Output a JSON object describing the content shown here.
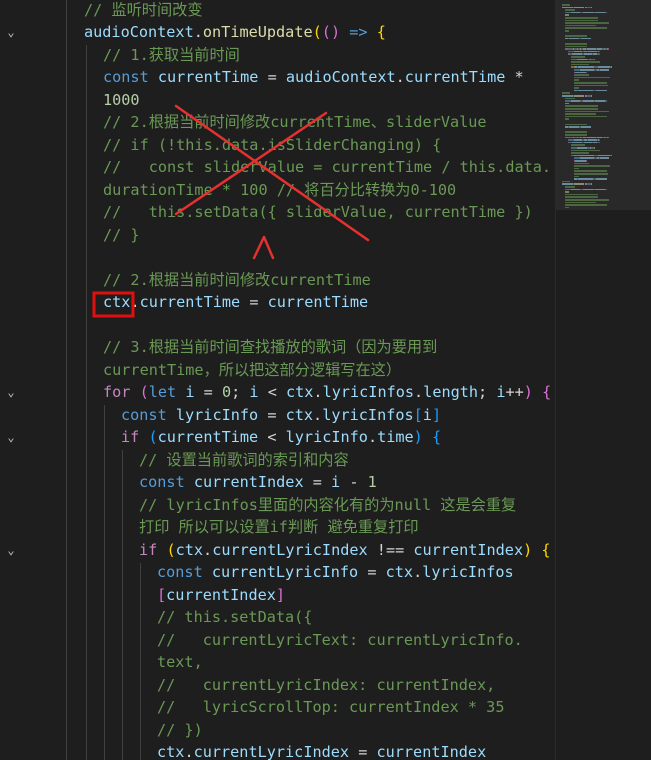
{
  "editor": {
    "lines": [
      {
        "indent": 84,
        "tokens": [
          [
            "cm",
            "// 监听时间改变"
          ]
        ]
      },
      {
        "indent": 84,
        "tokens": [
          [
            "var",
            "audioContext"
          ],
          [
            "pl",
            "."
          ],
          [
            "fn",
            "onTimeUpdate"
          ],
          [
            "br1",
            "("
          ],
          [
            "br2",
            "("
          ],
          [
            "br2",
            ")"
          ],
          [
            "pl",
            " "
          ],
          [
            "kw",
            "=>"
          ],
          [
            "pl",
            " "
          ],
          [
            "br1",
            "{"
          ]
        ]
      },
      {
        "indent": 103,
        "tokens": [
          [
            "cm",
            "// 1.获取当前时间"
          ]
        ]
      },
      {
        "indent": 103,
        "tokens": [
          [
            "kw",
            "const"
          ],
          [
            "pl",
            " "
          ],
          [
            "var",
            "currentTime"
          ],
          [
            "pl",
            " = "
          ],
          [
            "var",
            "audioContext"
          ],
          [
            "pl",
            "."
          ],
          [
            "var",
            "currentTime"
          ],
          [
            "pl",
            " *"
          ]
        ]
      },
      {
        "indent": 103,
        "tokens": [
          [
            "num",
            "1000"
          ]
        ]
      },
      {
        "indent": 103,
        "tokens": [
          [
            "cm",
            "// 2.根据当前时间修改currentTime、sliderValue"
          ]
        ]
      },
      {
        "indent": 103,
        "tokens": [
          [
            "cm",
            "// if (!this.data.isSliderChanging) {"
          ]
        ]
      },
      {
        "indent": 103,
        "tokens": [
          [
            "cm",
            "//   const sliderValue = currentTime / this.data."
          ]
        ]
      },
      {
        "indent": 103,
        "tokens": [
          [
            "cm",
            "durationTime * 100 // 将百分比转换为0-100"
          ]
        ]
      },
      {
        "indent": 103,
        "tokens": [
          [
            "cm",
            "//   this.setData({ sliderValue, currentTime })"
          ]
        ]
      },
      {
        "indent": 103,
        "tokens": [
          [
            "cm",
            "// }"
          ]
        ]
      },
      {
        "indent": 103,
        "tokens": []
      },
      {
        "indent": 103,
        "tokens": [
          [
            "cm",
            "// 2.根据当前时间修改currentTime"
          ]
        ]
      },
      {
        "indent": 103,
        "tokens": [
          [
            "var",
            "ctx"
          ],
          [
            "pl",
            "."
          ],
          [
            "var",
            "currentTime"
          ],
          [
            "pl",
            " = "
          ],
          [
            "var",
            "currentTime"
          ]
        ]
      },
      {
        "indent": 103,
        "tokens": []
      },
      {
        "indent": 103,
        "tokens": [
          [
            "cm",
            "// 3.根据当前时间查找播放的歌词（因为要用到"
          ]
        ]
      },
      {
        "indent": 103,
        "tokens": [
          [
            "cm",
            "currentTime，所以把这部分逻辑写在这）"
          ]
        ]
      },
      {
        "indent": 103,
        "tokens": [
          [
            "ctl",
            "for"
          ],
          [
            "pl",
            " "
          ],
          [
            "br2",
            "("
          ],
          [
            "kw",
            "let"
          ],
          [
            "pl",
            " "
          ],
          [
            "var",
            "i"
          ],
          [
            "pl",
            " = "
          ],
          [
            "num",
            "0"
          ],
          [
            "pl",
            "; "
          ],
          [
            "var",
            "i"
          ],
          [
            "pl",
            " < "
          ],
          [
            "var",
            "ctx"
          ],
          [
            "pl",
            "."
          ],
          [
            "var",
            "lyricInfos"
          ],
          [
            "pl",
            "."
          ],
          [
            "var",
            "length"
          ],
          [
            "pl",
            "; "
          ],
          [
            "var",
            "i"
          ],
          [
            "pl",
            "++"
          ],
          [
            "br2",
            ")"
          ],
          [
            "pl",
            " "
          ],
          [
            "br2",
            "{"
          ]
        ]
      },
      {
        "indent": 121,
        "tokens": [
          [
            "kw",
            "const"
          ],
          [
            "pl",
            " "
          ],
          [
            "var",
            "lyricInfo"
          ],
          [
            "pl",
            " = "
          ],
          [
            "var",
            "ctx"
          ],
          [
            "pl",
            "."
          ],
          [
            "var",
            "lyricInfos"
          ],
          [
            "br3",
            "["
          ],
          [
            "var",
            "i"
          ],
          [
            "br3",
            "]"
          ]
        ]
      },
      {
        "indent": 121,
        "tokens": [
          [
            "ctl",
            "if"
          ],
          [
            "pl",
            " "
          ],
          [
            "br3",
            "("
          ],
          [
            "var",
            "currentTime"
          ],
          [
            "pl",
            " < "
          ],
          [
            "var",
            "lyricInfo"
          ],
          [
            "pl",
            "."
          ],
          [
            "var",
            "time"
          ],
          [
            "br3",
            ")"
          ],
          [
            "pl",
            " "
          ],
          [
            "br3",
            "{"
          ]
        ]
      },
      {
        "indent": 139,
        "tokens": [
          [
            "cm",
            "// 设置当前歌词的索引和内容"
          ]
        ]
      },
      {
        "indent": 139,
        "tokens": [
          [
            "kw",
            "const"
          ],
          [
            "pl",
            " "
          ],
          [
            "var",
            "currentIndex"
          ],
          [
            "pl",
            " = "
          ],
          [
            "var",
            "i"
          ],
          [
            "pl",
            " - "
          ],
          [
            "num",
            "1"
          ]
        ]
      },
      {
        "indent": 139,
        "tokens": [
          [
            "cm",
            "// lyricInfos里面的内容化有的为null 这是会重复"
          ]
        ]
      },
      {
        "indent": 139,
        "tokens": [
          [
            "cm",
            "打印 所以可以设置if判断 避免重复打印"
          ]
        ]
      },
      {
        "indent": 139,
        "tokens": [
          [
            "ctl",
            "if"
          ],
          [
            "pl",
            " "
          ],
          [
            "br1",
            "("
          ],
          [
            "var",
            "ctx"
          ],
          [
            "pl",
            "."
          ],
          [
            "var",
            "currentLyricIndex"
          ],
          [
            "pl",
            " !== "
          ],
          [
            "var",
            "currentIndex"
          ],
          [
            "br1",
            ")"
          ],
          [
            "pl",
            " "
          ],
          [
            "br1",
            "{"
          ]
        ]
      },
      {
        "indent": 157,
        "tokens": [
          [
            "kw",
            "const"
          ],
          [
            "pl",
            " "
          ],
          [
            "var",
            "currentLyricInfo"
          ],
          [
            "pl",
            " = "
          ],
          [
            "var",
            "ctx"
          ],
          [
            "pl",
            "."
          ],
          [
            "var",
            "lyricInfos"
          ]
        ]
      },
      {
        "indent": 157,
        "tokens": [
          [
            "br2",
            "["
          ],
          [
            "var",
            "currentIndex"
          ],
          [
            "br2",
            "]"
          ]
        ]
      },
      {
        "indent": 157,
        "tokens": [
          [
            "cm",
            "// this.setData({"
          ]
        ]
      },
      {
        "indent": 157,
        "tokens": [
          [
            "cm",
            "//   currentLyricText: currentLyricInfo."
          ]
        ]
      },
      {
        "indent": 157,
        "tokens": [
          [
            "cm",
            "text,"
          ]
        ]
      },
      {
        "indent": 157,
        "tokens": [
          [
            "cm",
            "//   currentLyricIndex: currentIndex,"
          ]
        ]
      },
      {
        "indent": 157,
        "tokens": [
          [
            "cm",
            "//   lyricScrollTop: currentIndex * 35"
          ]
        ]
      },
      {
        "indent": 157,
        "tokens": [
          [
            "cm",
            "// })"
          ]
        ]
      },
      {
        "indent": 157,
        "tokens": [
          [
            "var",
            "ctx"
          ],
          [
            "pl",
            "."
          ],
          [
            "var",
            "currentLyricIndex"
          ],
          [
            "pl",
            " = "
          ],
          [
            "var",
            "currentIndex"
          ]
        ]
      }
    ]
  },
  "gutter": {
    "fold_glyph": "⌄",
    "fold_lines": [
      1,
      17,
      19,
      24
    ]
  },
  "annotations": {
    "cross_color": "#e5312f",
    "arrow_color": "#e5312f",
    "box_color": "#e01010"
  },
  "colors": {
    "background": "#1e1e1e",
    "comment": "#6a9955",
    "keyword": "#569cd6",
    "function": "#dcdcaa",
    "variable": "#9cdcfe",
    "number": "#b5cea8"
  }
}
